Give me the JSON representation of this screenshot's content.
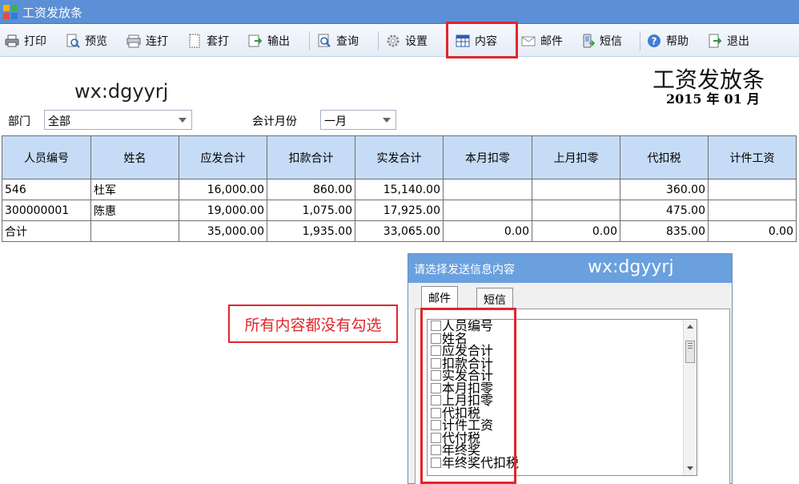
{
  "window": {
    "title": "工资发放条"
  },
  "toolbar": {
    "items": [
      {
        "label": "打印",
        "icon": "printer-icon"
      },
      {
        "label": "预览",
        "icon": "preview-icon"
      },
      {
        "label": "连打",
        "icon": "continuous-print-icon"
      },
      {
        "label": "套打",
        "icon": "template-print-icon"
      },
      {
        "label": "输出",
        "icon": "export-icon"
      },
      {
        "label": "查询",
        "icon": "query-icon"
      },
      {
        "label": "设置",
        "icon": "gear-icon"
      },
      {
        "label": "内容",
        "icon": "grid-icon",
        "highlighted": true
      },
      {
        "label": "邮件",
        "icon": "mail-icon"
      },
      {
        "label": "短信",
        "icon": "sms-icon"
      },
      {
        "label": "帮助",
        "icon": "help-icon"
      },
      {
        "label": "退出",
        "icon": "exit-icon"
      }
    ]
  },
  "watermark": "wx:dgyyrj",
  "report": {
    "title": "工资发放条",
    "year": "2015",
    "year_unit": "年",
    "month": "01",
    "month_unit": "月"
  },
  "filters": {
    "department_label": "部门",
    "department_value": "全部",
    "month_label": "会计月份",
    "month_value": "一月"
  },
  "table": {
    "columns": [
      "人员编号",
      "姓名",
      "应发合计",
      "扣款合计",
      "实发合计",
      "本月扣零",
      "上月扣零",
      "代扣税",
      "计件工资"
    ],
    "rows": [
      [
        "546",
        "杜军",
        "16,000.00",
        "860.00",
        "15,140.00",
        "",
        "",
        "360.00",
        ""
      ],
      [
        "300000001",
        "陈惠",
        "19,000.00",
        "1,075.00",
        "17,925.00",
        "",
        "",
        "475.00",
        ""
      ],
      [
        "合计",
        "",
        "35,000.00",
        "1,935.00",
        "33,065.00",
        "0.00",
        "0.00",
        "835.00",
        "0.00"
      ]
    ]
  },
  "annotation": "所有内容都没有勾选",
  "dialog": {
    "title": "请选择发送信息内容",
    "watermark": "wx:dgyyrj",
    "tabs": [
      "邮件",
      "短信"
    ],
    "items": [
      "人员编号",
      "姓名",
      "应发合计",
      "扣款合计",
      "实发合计",
      "本月扣零",
      "上月扣零",
      "代扣税",
      "计件工资",
      "代付税",
      "年终奖",
      "年终奖代扣税"
    ]
  },
  "colors": {
    "titlebar": "#5b8fd6",
    "header_cell": "#c6dcf6",
    "dialog_title": "#6aa0de",
    "highlight_red": "#e0262b"
  }
}
